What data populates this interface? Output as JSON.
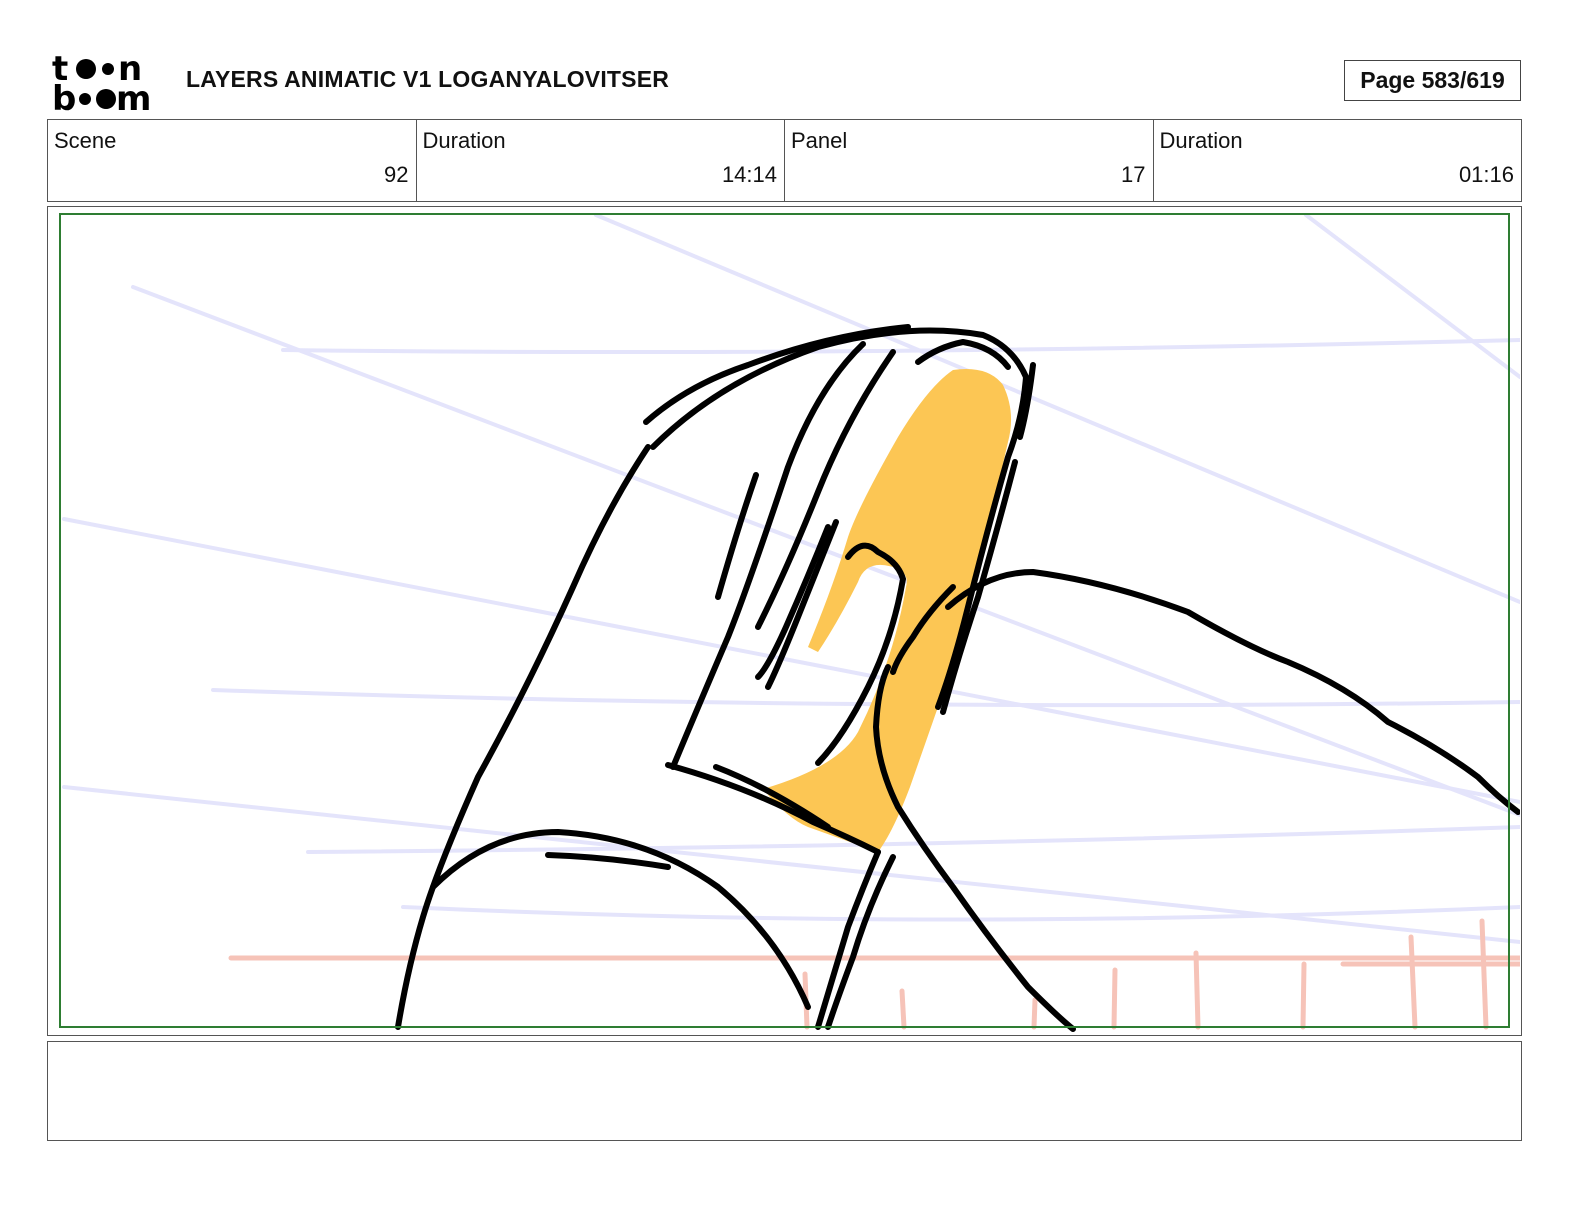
{
  "header": {
    "logo_text": "toon boom",
    "title": "LAYERS ANIMATIC V1 LOGANYALOVITSER",
    "page_indicator": "Page 583/619"
  },
  "info": [
    {
      "label": "Scene",
      "value": "92"
    },
    {
      "label": "Duration",
      "value": "14:14"
    },
    {
      "label": "Panel",
      "value": "17"
    },
    {
      "label": "Duration",
      "value": "01:16"
    }
  ],
  "panel": {
    "safe_frame_color": "#2e7d32",
    "guide_line_color": "#e4e4fb",
    "horizon_line_color": "#f6c3b8",
    "fill_color": "#fcc654",
    "ink_color": "#000000"
  },
  "notes": {
    "text": ""
  }
}
